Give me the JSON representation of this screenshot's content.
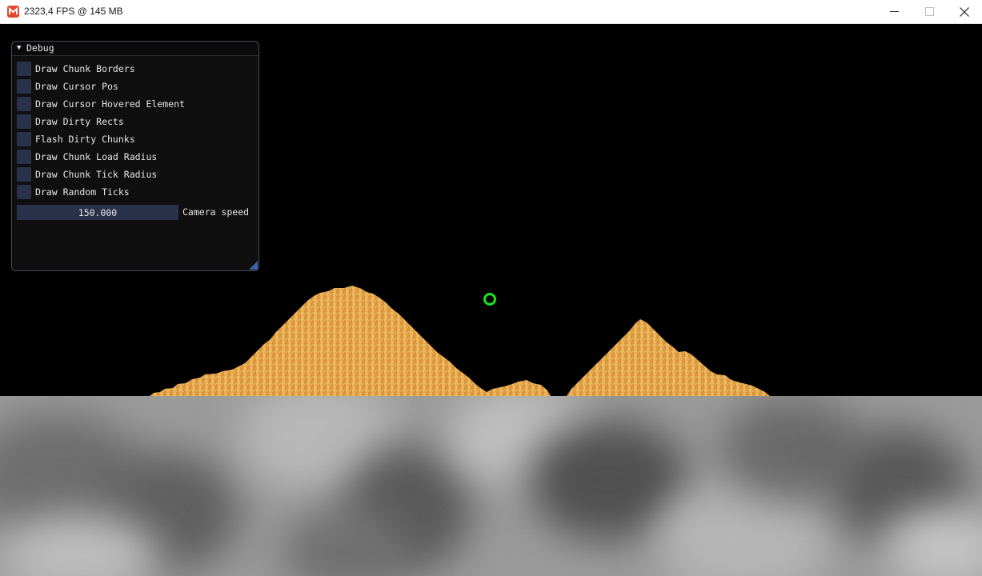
{
  "window": {
    "title": "2323,4 FPS @ 145 MB",
    "icon": "monogame-logo-icon",
    "controls": [
      "minimize-icon",
      "maximize-icon",
      "close-icon"
    ]
  },
  "debug_panel": {
    "title": "Debug",
    "collapse_icon": "triangle-down-icon",
    "checkboxes": [
      {
        "label": "Draw Chunk Borders",
        "checked": false
      },
      {
        "label": "Draw Cursor Pos",
        "checked": false
      },
      {
        "label": "Draw Cursor Hovered Element",
        "checked": false
      },
      {
        "label": "Draw Dirty Rects",
        "checked": false
      },
      {
        "label": "Flash Dirty Chunks",
        "checked": false
      },
      {
        "label": "Draw Chunk Load Radius",
        "checked": false
      },
      {
        "label": "Draw Chunk Tick Radius",
        "checked": false
      },
      {
        "label": "Draw Random Ticks",
        "checked": false
      }
    ],
    "camera_speed": {
      "value": "150.000",
      "label": "Camera speed"
    }
  },
  "colors": {
    "sand": "#e8a64a",
    "cursor_ring": "#1ee01e",
    "widget_bg": "#29324a",
    "accent": "#3a64a6"
  }
}
